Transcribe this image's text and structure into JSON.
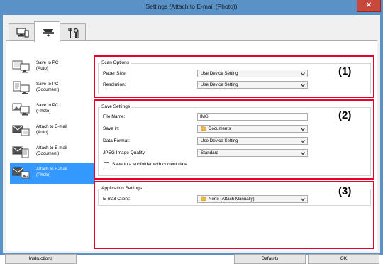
{
  "window": {
    "title": "Settings (Attach to E-mail (Photo))",
    "close_glyph": "✕"
  },
  "tabs": [
    {
      "icon": "scan-from-computer-icon",
      "active": false
    },
    {
      "icon": "scan-from-panel-icon",
      "active": true
    },
    {
      "icon": "general-settings-tools-icon",
      "active": false
    }
  ],
  "nav": {
    "items": [
      {
        "line1": "Save to PC",
        "line2": "(Auto)",
        "icon": "save-to-pc-auto-icon",
        "selected": false
      },
      {
        "line1": "Save to PC",
        "line2": "(Document)",
        "icon": "save-to-pc-document-icon",
        "selected": false
      },
      {
        "line1": "Save to PC",
        "line2": "(Photo)",
        "icon": "save-to-pc-photo-icon",
        "selected": false
      },
      {
        "line1": "Attach to E-mail",
        "line2": "(Auto)",
        "icon": "attach-email-auto-icon",
        "selected": false
      },
      {
        "line1": "Attach to E-mail",
        "line2": "(Document)",
        "icon": "attach-email-document-icon",
        "selected": false
      },
      {
        "line1": "Attach to E-mail",
        "line2": "(Photo)",
        "icon": "attach-email-photo-icon",
        "selected": true
      }
    ]
  },
  "scan_options": {
    "title": "Scan Options",
    "paper_size_label": "Paper Size:",
    "paper_size_value": "Use Device Setting",
    "resolution_label": "Resolution:",
    "resolution_value": "Use Device Setting",
    "marker": "(1)"
  },
  "save_settings": {
    "title": "Save Settings",
    "file_name_label": "File Name:",
    "file_name_value": "IMG",
    "save_in_label": "Save in:",
    "save_in_value": "Documents",
    "data_format_label": "Data Format:",
    "data_format_value": "Use Device Setting",
    "jpeg_quality_label": "JPEG Image Quality:",
    "jpeg_quality_value": "Standard",
    "subfolder_label": "Save to a subfolder with current date",
    "subfolder_checked": false,
    "marker": "(2)"
  },
  "application_settings": {
    "title": "Application Settings",
    "email_client_label": "E-mail Client:",
    "email_client_value": "None (Attach Manually)",
    "marker": "(3)"
  },
  "footer": {
    "instructions_label": "Instructions",
    "defaults_label": "Defaults",
    "ok_label": "OK"
  },
  "colors": {
    "title_bar": "#5a92c8",
    "selection": "#3399ff",
    "highlight_box": "#e8002b",
    "close_button": "#c9483c"
  }
}
